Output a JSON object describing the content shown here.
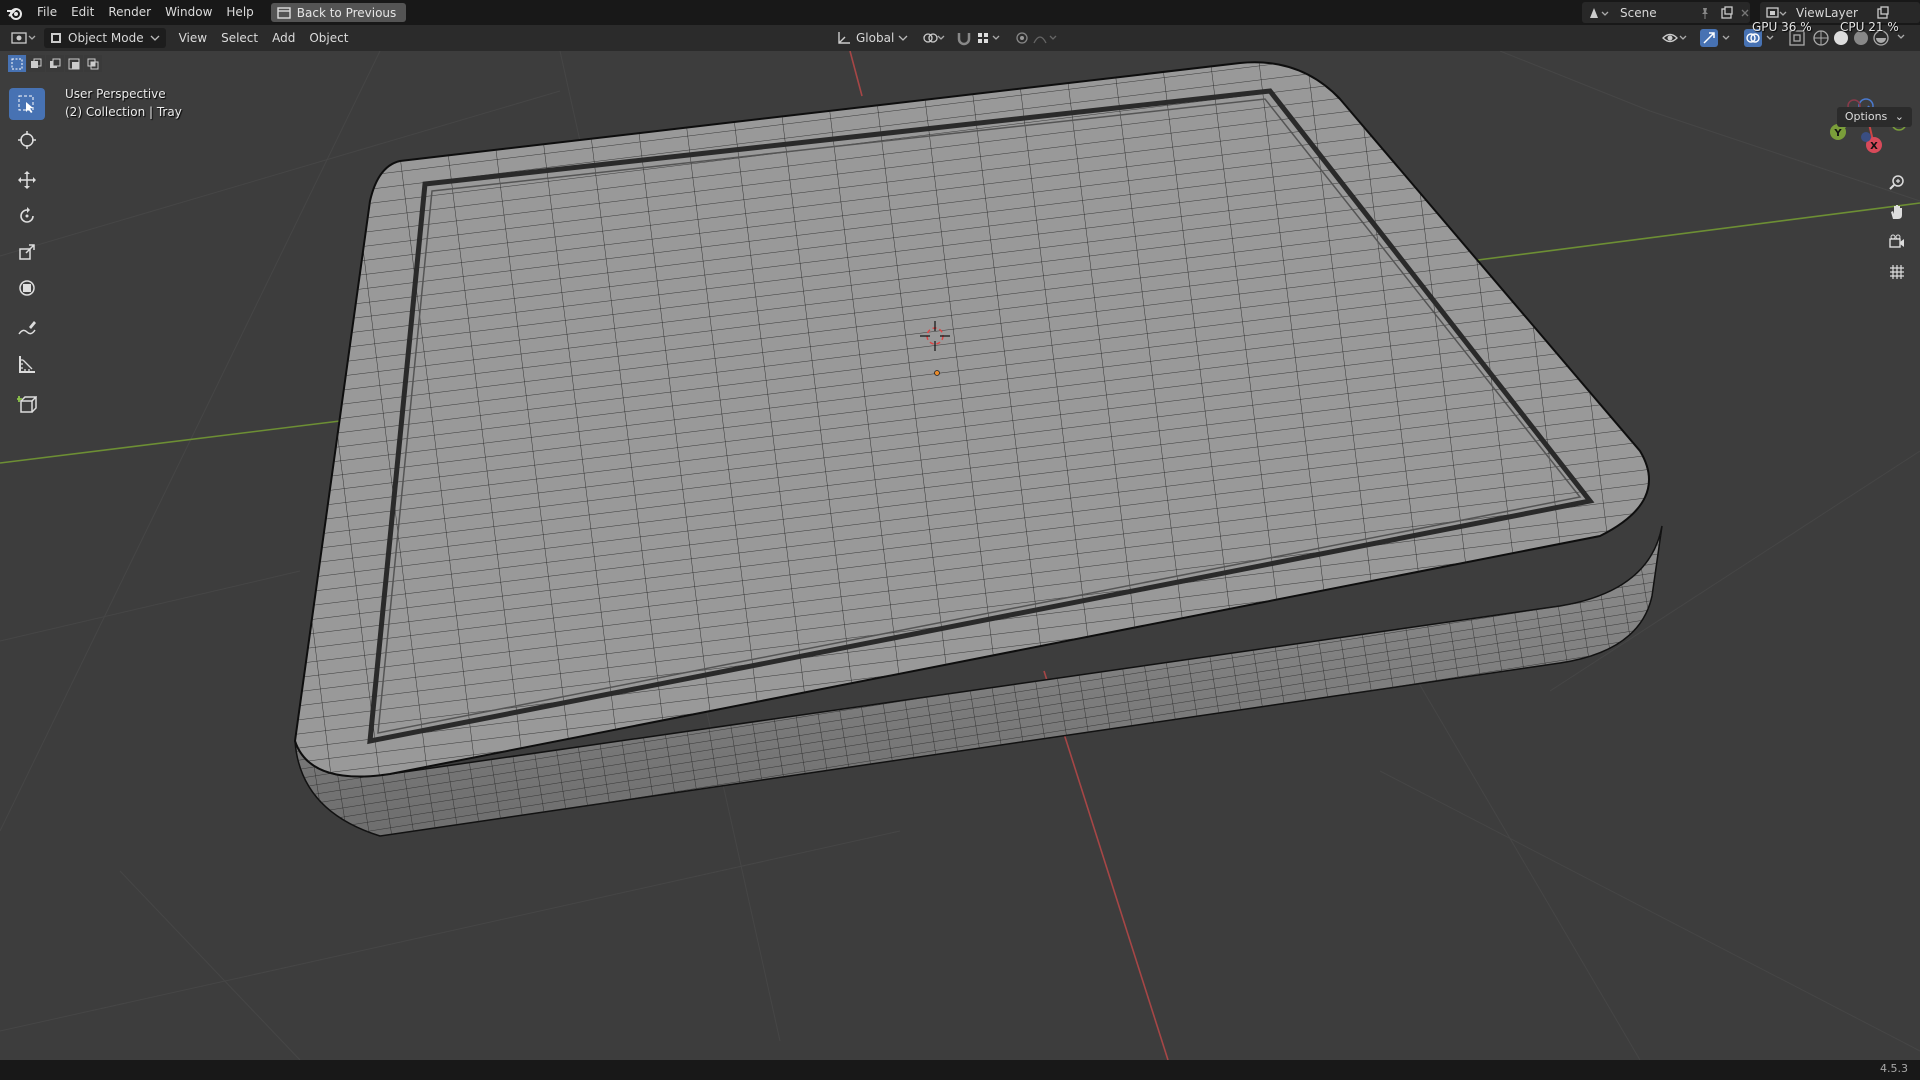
{
  "topbar": {
    "menus": [
      "File",
      "Edit",
      "Render",
      "Window",
      "Help"
    ],
    "back_label": "Back to Previous",
    "scene": "Scene",
    "view_layer": "ViewLayer",
    "gpu_label": "GPU",
    "gpu_value": "36 %",
    "cpu_label": "CPU",
    "cpu_value": "21 %"
  },
  "header": {
    "mode": "Object Mode",
    "menus": [
      "View",
      "Select",
      "Add",
      "Object"
    ],
    "orientation": "Global",
    "options": "Options"
  },
  "viewport": {
    "perspective": "User Perspective",
    "collection": "(2) Collection | Tray",
    "background": "#3d3d3d",
    "axis_x_color": "#c84a4a",
    "axis_y_color": "#7a9e3a",
    "gizmo": {
      "x": "X",
      "y": "Y"
    }
  },
  "statusbar": {
    "version": "4.5.3"
  }
}
